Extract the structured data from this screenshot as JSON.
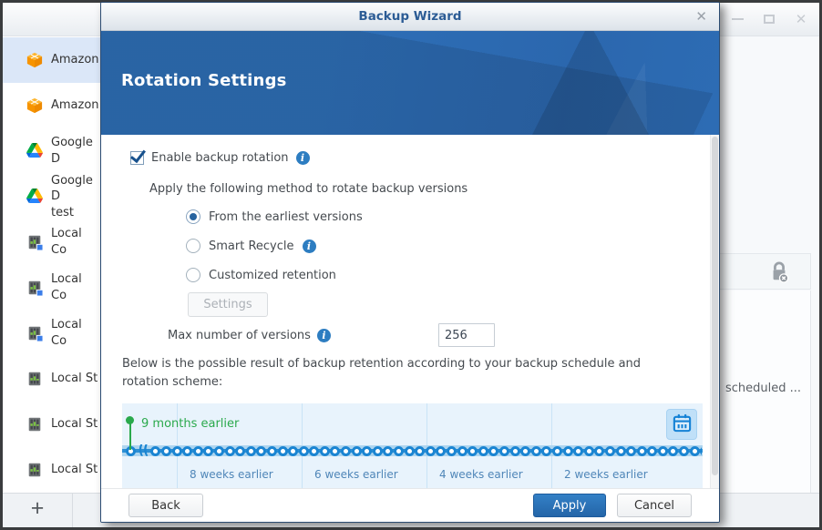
{
  "app": {
    "sidebar": {
      "items": [
        {
          "label": "Amazon",
          "icon": "amazon-cloud-icon",
          "selected": true
        },
        {
          "label": "Amazon",
          "icon": "amazon-cloud-icon",
          "selected": false
        },
        {
          "label": "Google D",
          "icon": "google-drive-icon",
          "selected": false
        },
        {
          "label": "Google D\ntest",
          "icon": "google-drive-icon",
          "selected": false
        },
        {
          "label": "Local Co",
          "icon": "local-server-linked-icon",
          "selected": false
        },
        {
          "label": "Local Co",
          "icon": "local-server-linked-icon",
          "selected": false
        },
        {
          "label": "Local Co",
          "icon": "local-server-linked-icon",
          "selected": false
        },
        {
          "label": "Local St",
          "icon": "local-server-icon",
          "selected": false
        },
        {
          "label": "Local St",
          "icon": "local-server-icon",
          "selected": false
        },
        {
          "label": "Local St",
          "icon": "local-server-icon",
          "selected": false
        }
      ],
      "add_button_glyph": "+"
    },
    "background_panel": {
      "clipped_text": "scheduled ..."
    }
  },
  "dialog": {
    "title": "Backup Wizard",
    "close_glyph": "✕",
    "header": "Rotation Settings",
    "rotation": {
      "enable_label": "Enable backup rotation",
      "method_intro": "Apply the following method to rotate backup versions",
      "methods": [
        {
          "label": "From the earliest versions",
          "selected": true,
          "has_info": false
        },
        {
          "label": "Smart Recycle",
          "selected": false,
          "has_info": true
        },
        {
          "label": "Customized retention",
          "selected": false,
          "has_info": false
        }
      ],
      "settings_button_label": "Settings",
      "settings_enabled": false,
      "max_versions_label": "Max number of versions",
      "max_versions_value": "256"
    },
    "result_note": "Below is the possible result of backup retention according to your backup schedule and rotation scheme:",
    "timeline": {
      "start_label": "9 months earlier",
      "break_glyph": "((",
      "column_labels": [
        "8 weeks earlier",
        "6 weeks earlier",
        "4 weeks earlier",
        "2 weeks earlier"
      ],
      "version_marker_count": 56
    },
    "footer": {
      "back_label": "Back",
      "apply_label": "Apply",
      "cancel_label": "Cancel"
    }
  },
  "colors": {
    "accent_blue": "#2a70b8",
    "banner_blue": "#2d6cb4",
    "selection_blue": "#dbe7f8",
    "timeline_green": "#2aa94c",
    "timeline_marker_blue": "#1b85d2",
    "timeline_bg": "#e8f3fc"
  }
}
